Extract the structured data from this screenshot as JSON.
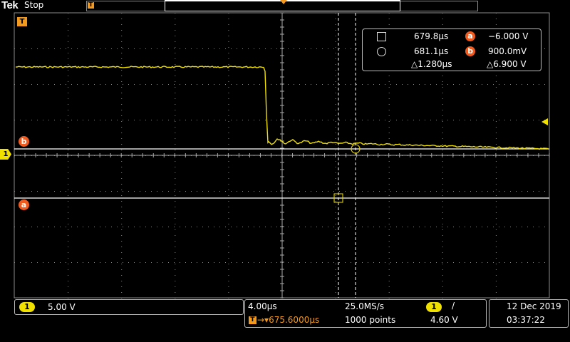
{
  "header": {
    "brand": "Tek",
    "run_state": "Stop",
    "trigger_position_icon": "trigger-T-icon"
  },
  "waveform": {
    "channel_marker": "1",
    "cursor_a_label": "a",
    "cursor_b_label": "b",
    "trigger_marker": "T",
    "colors": {
      "ch1": "#f0e000",
      "cursor": "#f05a1e",
      "trigger": "#f39a1e",
      "grid": "#8a8a8a"
    }
  },
  "cursor_readout": {
    "time_a": "679.8µs",
    "time_b": "681.1µs",
    "delta_time": "△1.280µs",
    "volt_a_label": "a",
    "volt_a": "−6.000 V",
    "volt_b_label": "b",
    "volt_b": "900.0mV",
    "delta_volt": "△6.900 V"
  },
  "channel_panel": {
    "channel": "1",
    "scale": "5.00 V"
  },
  "timebase_panel": {
    "time_per_div": "4.00µs",
    "sample_rate": "25.0MS/s",
    "trigger_channel": "1",
    "trigger_slope": "/",
    "trigger_icon": "T",
    "trigger_delay": "→▾675.6000µs",
    "record_length": "1000 points",
    "trigger_level": "4.60 V"
  },
  "datetime_panel": {
    "date": "12 Dec  2019",
    "time": "03:37:22"
  }
}
